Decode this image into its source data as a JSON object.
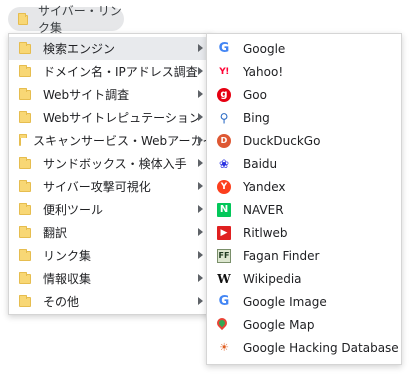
{
  "bookmark_bar": {
    "folder_label": "サイバー・リンク集"
  },
  "main_menu": {
    "items": [
      {
        "label": "検索エンジン"
      },
      {
        "label": "ドメイン名・IPアドレス調査"
      },
      {
        "label": "Webサイト調査"
      },
      {
        "label": "Webサイトレピュテーション"
      },
      {
        "label": "スキャンサービス・Webアーカイブ"
      },
      {
        "label": "サンドボックス・検体入手"
      },
      {
        "label": "サイバー攻撃可視化"
      },
      {
        "label": "便利ツール"
      },
      {
        "label": "翻訳"
      },
      {
        "label": "リンク集"
      },
      {
        "label": "情報収集"
      },
      {
        "label": "その他"
      }
    ],
    "active_item": "検索エンジン"
  },
  "sub_menu": {
    "items": [
      {
        "label": "Google",
        "icon": "google-icon",
        "glyph": "G"
      },
      {
        "label": "Yahoo!",
        "icon": "yahoo-icon",
        "glyph": "Y!"
      },
      {
        "label": "Goo",
        "icon": "goo-icon",
        "glyph": "g"
      },
      {
        "label": "Bing",
        "icon": "bing-icon",
        "glyph": "⚲"
      },
      {
        "label": "DuckDuckGo",
        "icon": "duckduckgo-icon",
        "glyph": "D"
      },
      {
        "label": "Baidu",
        "icon": "baidu-icon",
        "glyph": "❀"
      },
      {
        "label": "Yandex",
        "icon": "yandex-icon",
        "glyph": "Y"
      },
      {
        "label": "NAVER",
        "icon": "naver-icon",
        "glyph": "N"
      },
      {
        "label": "Ritlweb",
        "icon": "ritlweb-icon",
        "glyph": "▶"
      },
      {
        "label": "Fagan Finder",
        "icon": "fagan-finder-icon",
        "glyph": "FF"
      },
      {
        "label": "Wikipedia",
        "icon": "wikipedia-icon",
        "glyph": "W"
      },
      {
        "label": "Google Image",
        "icon": "google-image-icon",
        "glyph": "G"
      },
      {
        "label": "Google Map",
        "icon": "google-map-icon",
        "glyph": ""
      },
      {
        "label": "Google Hacking Database",
        "icon": "ghdb-icon",
        "glyph": "☀"
      }
    ]
  },
  "colors": {
    "folder": "#f8d775",
    "active_row": "#e8eaed",
    "chip_bg": "#e6e7e9"
  }
}
